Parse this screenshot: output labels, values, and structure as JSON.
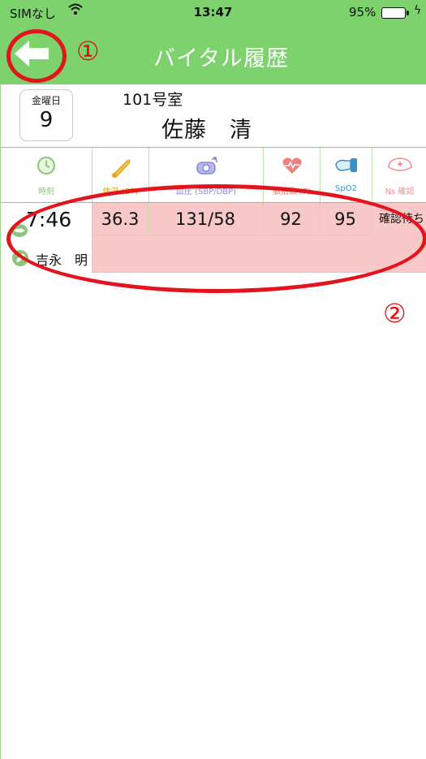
{
  "status_bar": {
    "carrier": "SIMなし",
    "time": "13:47",
    "battery_percent": "95%"
  },
  "nav": {
    "title": "バイタル履歴",
    "back_icon": "back-arrow-icon",
    "annotation_marker": "①"
  },
  "patient": {
    "day_of_week": "金曜日",
    "day": "9",
    "room": "101号室",
    "name": "佐藤　清"
  },
  "table_header": {
    "columns": [
      {
        "label": "時刻",
        "icon": "clock-icon",
        "color": "#8cc47a"
      },
      {
        "label": "体温 (BT)",
        "icon": "thermometer-icon",
        "color": "#e3a325"
      },
      {
        "label": "血圧 (SBP/DBP)",
        "icon": "blood-pressure-icon",
        "color": "#8a8ad6"
      },
      {
        "label": "脈拍数 (P)",
        "icon": "heart-pulse-icon",
        "color": "#e87878"
      },
      {
        "label": "SpO2",
        "icon": "pulse-oximeter-icon",
        "color": "#3b8fc7"
      },
      {
        "label": "Ns 確認",
        "icon": "nurse-cap-icon",
        "color": "#f08f8f"
      }
    ]
  },
  "record": {
    "time": "7:46",
    "temperature": "36.3",
    "blood_pressure": "131/58",
    "pulse": "92",
    "spo2": "95",
    "confirm_status": "確認待ち",
    "staff_name": "吉永　明",
    "memo": ""
  },
  "annotations": {
    "marker_2": "②"
  },
  "colors": {
    "header_green": "#7dd26d",
    "row_highlight": "#f9c8c8",
    "annotation_red": "#e3141c"
  }
}
